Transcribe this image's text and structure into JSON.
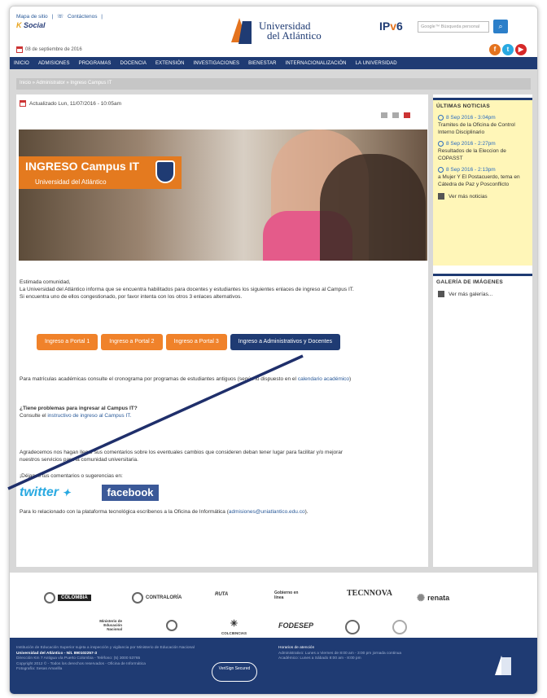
{
  "header": {
    "top_links": [
      "Mapa de sitio",
      "|",
      "Contáctenos",
      "|"
    ],
    "social": "Social",
    "social_prefix": "K",
    "date": "08 de septiembre de 2016",
    "logo_line1": "Universidad",
    "logo_line2": "del Atlántico",
    "ipv6": "IPv6",
    "search_placeholder": "Google™ Búsqueda personal",
    "search_btn": "Q"
  },
  "nav": [
    "INICIO",
    "ADMISIONES",
    "PROGRAMAS",
    "DOCENCIA",
    "EXTENSIÓN",
    "INVESTIGACIONES",
    "BIENESTAR",
    "INTERNACIONALIZACIÓN",
    "LA UNIVERSIDAD"
  ],
  "breadcrumb": "Inicio » Administrator » Ingreso Campus IT",
  "article": {
    "updated": "Actualizado Lun, 11/07/2016 - 10:05am",
    "banner_title": "INGRESO Campus IT",
    "banner_subtitle": "Universidad del Atlántico",
    "greeting": "Estimada comunidad,",
    "intro1": "La Universidad del Atlántico informa que se encuentra habilitados para docentes y estudiantes los siguientes enlaces de ingreso al Campus IT.",
    "intro2": "Si encuentra uno de ellos congestionado, por favor intenta con los otros 3 enlaces alternativos.",
    "buttons": [
      "Ingreso a Portal 1",
      "Ingreso a Portal 2",
      "Ingreso a Portal 3",
      "Ingreso a Administrativos y Docentes"
    ],
    "matriculas_text": "Para matrículas académicas consulte el cronograma por programas de estudiantes antiguos (según lo dispuesto en el",
    "matriculas_link": "calendario académico",
    "matriculas_end": ")",
    "problems_q": "¿Tiene problemas para ingresar al Campus IT?",
    "problems_text": "Consulte el",
    "problems_link": "instructivo de ingreso al Campus IT.",
    "thanks1": "Agradecemos nos hagan llegar sus comentarios sobre los eventuales cambios que consideren deban tener lugar para facilitar y/o mejorar",
    "thanks2": "nuestros servicios para la comunidad universitaria.",
    "comments": "¡Déjanos tus comentarios o sugerencias en:",
    "twitter": "twitter",
    "facebook": "facebook",
    "contact_text": "Para lo relacionado con la plataforma tecnológica escribenos a la Oficina de Informática (",
    "contact_email": "admisiones@uniatlantico.edu.co",
    "contact_end": ")."
  },
  "sidebar": {
    "news_title": "ÚLTIMAS NOTICIAS",
    "news": [
      {
        "date": "8 Sep 2016 - 3:04pm",
        "title": "Tramites de la Oficina de Control Interno Disciplinario"
      },
      {
        "date": "8 Sep 2016 - 2:27pm",
        "title": "Resultados de la Eleccion de COPASST"
      },
      {
        "date": "8 Sep 2016 - 2:13pm",
        "title": "a Mujer Y El Postacuerdo, tema en Cátedra de Paz y Posconflicto"
      }
    ],
    "news_more": "Ver más noticias",
    "gallery_title": "GALERÍA DE IMÁGENES",
    "gallery_more": "Ver más galerías..."
  },
  "partners": {
    "row1": [
      "COLOMBIA",
      "CONTRALORÍA",
      "RUTA",
      "Gobierno en línea",
      "TECNNOVA",
      "renata"
    ],
    "row2": [
      "Ministerio de Educación Nacional",
      "COLCIENCIAS",
      "FODESEP"
    ]
  },
  "footer": {
    "line1": "Institución de Educación Superior sujeta a inspección y vigilancia por Ministerio de Educación Nacional",
    "line2": "Universidad del Atlántico - Nit. 890102257-3",
    "line3": "Dirección Km 7 Antigua vía Puerto Colombia - Teléfono: (5) 3000 53765",
    "line4": "Copyright 2012 © - Todos los derechos reservados - Oficina de Informática",
    "line5": "Fotografía: Sesas Amarilla",
    "hours_title": "Horarios de atención",
    "hours1": "Administrativo: Lunes a Viernes de 8:00 am - 3:00 pm jornada continua",
    "hours2": "Académico: Lunes a Sábado 8:00 am - 8:00 pm",
    "verisign": "VeriSign Secured"
  },
  "colors": {
    "primary": "#1f3b73",
    "accent": "#f0822a",
    "link": "#2a5a99"
  }
}
